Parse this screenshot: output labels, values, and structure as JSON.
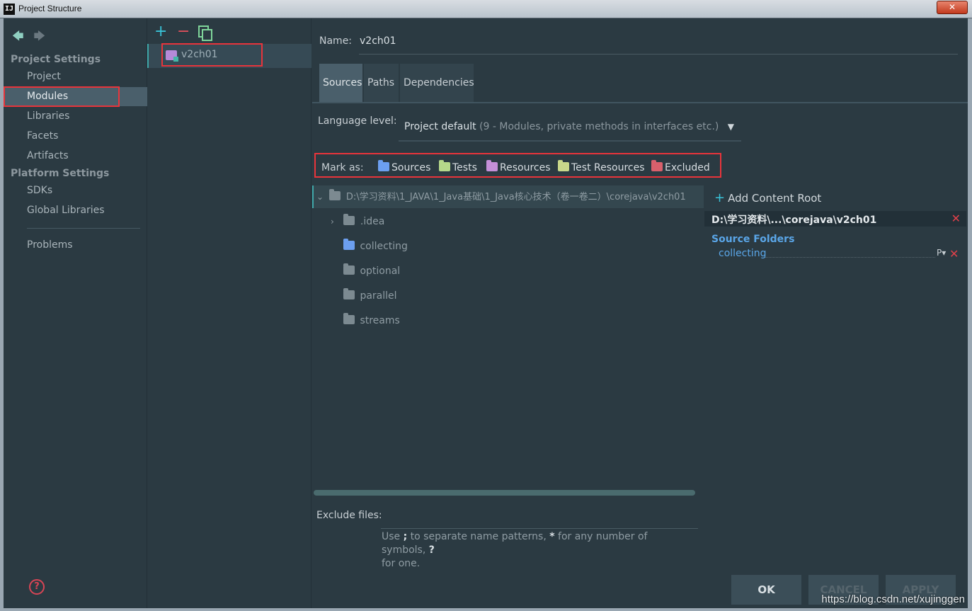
{
  "window": {
    "title": "Project Structure",
    "app_icon": "IJ",
    "close_label": "✕"
  },
  "nav": {
    "back_icon": "arrow-left-icon",
    "forward_icon": "arrow-right-icon",
    "project_settings": "Project Settings",
    "project_items": [
      "Project",
      "Modules",
      "Libraries",
      "Facets",
      "Artifacts"
    ],
    "selected": "Modules",
    "platform_settings": "Platform Settings",
    "platform_items": [
      "SDKs",
      "Global Libraries"
    ],
    "problems": "Problems",
    "help_label": "?"
  },
  "modules": {
    "add_label": "+",
    "remove_label": "−",
    "items": [
      {
        "label": "v2ch01"
      }
    ]
  },
  "main": {
    "name_label": "Name:",
    "name_value": "v2ch01",
    "tabs": [
      {
        "label": "Sources",
        "active": true
      },
      {
        "label": "Paths",
        "active": false
      },
      {
        "label": "Dependencies",
        "active": false
      }
    ],
    "language_level_label": "Language level:",
    "language_level_value": "Project default",
    "language_level_hint": "(9 - Modules, private methods in interfaces etc.)",
    "language_caret": "▼",
    "mark_as_label": "Mark as:",
    "mark_as": [
      {
        "label": "Sources",
        "color": "#6c9ff0"
      },
      {
        "label": "Tests",
        "color": "#b5d88a"
      },
      {
        "label": "Resources",
        "color": "#c48fd8"
      },
      {
        "label": "Test Resources",
        "color": "#c9d88a"
      },
      {
        "label": "Excluded",
        "color": "#d9606c"
      }
    ],
    "tree": {
      "root_path": "D:\\学习资料\\1_JAVA\\1_Java基础\\1_Java核心技术（卷一卷二）\\corejava\\v2ch01",
      "expand_chevron": "⌄",
      "collapsed_chevron": "›",
      "children": [
        {
          "label": ".idea",
          "expandable": true,
          "color": "#7c8a91"
        },
        {
          "label": "collecting",
          "expandable": false,
          "color": "#6c9ff0"
        },
        {
          "label": "optional",
          "expandable": false,
          "color": "#7c8a91"
        },
        {
          "label": "parallel",
          "expandable": false,
          "color": "#7c8a91"
        },
        {
          "label": "streams",
          "expandable": false,
          "color": "#7c8a91"
        }
      ]
    },
    "exclude_files_label": "Exclude files:",
    "exclude_hint_parts": [
      "Use ",
      ";",
      " to separate name patterns, ",
      "*",
      " for any number of symbols, ",
      "?",
      " for one."
    ]
  },
  "content_root": {
    "add_icon": "+",
    "add_label": "Add Content Root",
    "root_path": "D:\\学习资料\\...\\corejava\\v2ch01",
    "remove_icon": "✕",
    "source_folders_title": "Source Folders",
    "source_folders": [
      "collecting"
    ],
    "package_prefix_icon": "P▾"
  },
  "buttons": {
    "ok": "OK",
    "cancel": "CANCEL",
    "apply": "APPLY"
  },
  "watermark": "https://blog.csdn.net/xujinggen",
  "colors": {
    "highlight_box": "#e8343b",
    "accent_teal": "#3fa7a8",
    "source_blue": "#5aa6e8"
  }
}
